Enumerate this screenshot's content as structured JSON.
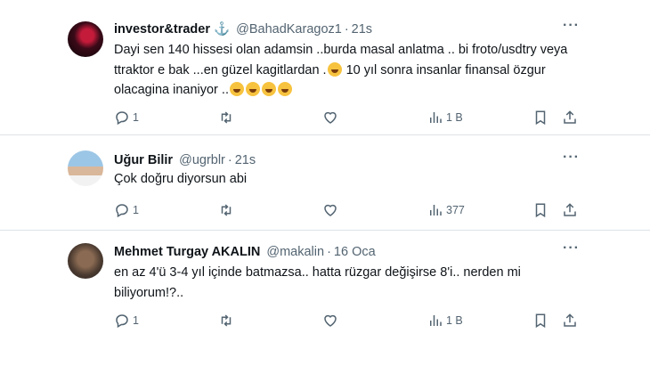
{
  "tweets": [
    {
      "name": "investor&trader",
      "badge": "⚓",
      "handle": "@BahadKaragoz1",
      "time": "21s",
      "text": "Dayi sen 140 hissesi olan adamsin ..burda masal anlatma .. bi froto/usdtry veya ttraktor e bak ...en güzel kagitlardan .",
      "text2": " 10 yıl sonra insanlar finansal özgur olacagina inaniyor ..",
      "emoji_icons": [
        "grinning-squinting-face",
        "rolling-laughing-face",
        "rolling-laughing-face",
        "rolling-laughing-face",
        "grinning-sweat-face"
      ],
      "replies": "1",
      "views": "1 B"
    },
    {
      "name": "Uğur Bilir",
      "handle": "@ugrblr",
      "time": "21s",
      "text": "Çok doğru diyorsun abi",
      "replies": "1",
      "views": "377"
    },
    {
      "name": "Mehmet Turgay AKALIN",
      "handle": "@makalin",
      "time": "16 Oca",
      "text": "en az 4'ü 3-4 yıl içinde batmazsa.. hatta rüzgar değişirse 8'i.. nerden mi biliyorum!?..",
      "replies": "1",
      "views": "1 B"
    }
  ],
  "common": {
    "dot": "·",
    "more": "···"
  },
  "colors": {
    "text": "#0f1419",
    "muted": "#536471",
    "accent": "#1d9bf0",
    "divider": "#dfe3e6"
  }
}
